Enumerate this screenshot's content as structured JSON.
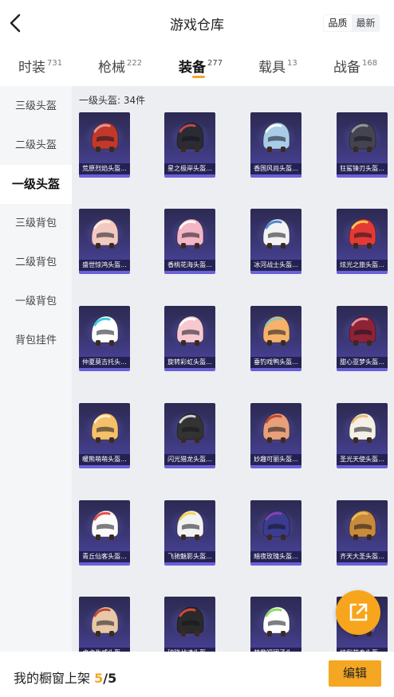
{
  "header": {
    "title": "游戏仓库",
    "sort": [
      "品质",
      "最新"
    ],
    "back_icon": "back-arrow-icon"
  },
  "tabs": [
    {
      "label": "时装",
      "count": "731",
      "active": false
    },
    {
      "label": "枪械",
      "count": "222",
      "active": false
    },
    {
      "label": "装备",
      "count": "277",
      "active": true
    },
    {
      "label": "载具",
      "count": "13",
      "active": false
    },
    {
      "label": "战备",
      "count": "168",
      "active": false
    }
  ],
  "sidebar": {
    "items": [
      {
        "label": "三级头盔",
        "active": false
      },
      {
        "label": "二级头盔",
        "active": false
      },
      {
        "label": "一级头盔",
        "active": true
      },
      {
        "label": "三级背包",
        "active": false
      },
      {
        "label": "二级背包",
        "active": false
      },
      {
        "label": "一级背包",
        "active": false
      },
      {
        "label": "背包挂件",
        "active": false
      }
    ]
  },
  "content": {
    "heading_prefix": "一级头盔:",
    "heading_count": "34件",
    "items": [
      {
        "name": "荒原烈焰头盔...",
        "color": "#c0392b",
        "accent": "#e8a0a0"
      },
      {
        "name": "星之极岸头盔...",
        "color": "#2b2b35",
        "accent": "#d24a4a"
      },
      {
        "name": "香国风尚头盔...",
        "color": "#a9cde8",
        "accent": "#ffffff"
      },
      {
        "name": "狂鲨锋刃头盔...",
        "color": "#444450",
        "accent": "#9aa0aa"
      },
      {
        "name": "盛世惊鸿头盔...",
        "color": "#f2c9c0",
        "accent": "#fff0e8"
      },
      {
        "name": "香桃花海头盔...",
        "color": "#f4b6c4",
        "accent": "#ffffff"
      },
      {
        "name": "冰河战士头盔...",
        "color": "#f2f2f2",
        "accent": "#3a7bd5"
      },
      {
        "name": "炫光之旅头盔...",
        "color": "#e53935",
        "accent": "#ffd54f"
      },
      {
        "name": "仲夏莫吉托头...",
        "color": "#ffffff",
        "accent": "#26c6da"
      },
      {
        "name": "旋转彩虹头盔...",
        "color": "#f8c8d0",
        "accent": "#ffffff"
      },
      {
        "name": "垂钓戏鸭头盔...",
        "color": "#f6b26b",
        "accent": "#7fc8c8"
      },
      {
        "name": "甜心亚梦头盔...",
        "color": "#8e2236",
        "accent": "#e89aa8"
      },
      {
        "name": "暖熊萌萌头盔...",
        "color": "#f4c06a",
        "accent": "#fff3d0"
      },
      {
        "name": "闪光猎龙头盔...",
        "color": "#333333",
        "accent": "#e0e0e0"
      },
      {
        "name": "妙趣可丽头盔...",
        "color": "#e8a07a",
        "accent": "#c0392b"
      },
      {
        "name": "圣光天使头盔...",
        "color": "#f5f0e6",
        "accent": "#e6b86a"
      },
      {
        "name": "青丘仙客头盔...",
        "color": "#fafafa",
        "accent": "#e53935"
      },
      {
        "name": "飞驰魅影头盔...",
        "color": "#f2f2f2",
        "accent": "#f4d03f"
      },
      {
        "name": "暗夜玫瑰头盔...",
        "color": "#3b3b8f",
        "accent": "#8e44ad"
      },
      {
        "name": "齐天大圣头盔...",
        "color": "#c98a3a",
        "accent": "#f0c060"
      },
      {
        "name": "虎虎生威头盔...",
        "color": "#e8c8a8",
        "accent": "#c0392b"
      },
      {
        "name": "破晓战魂头盔...",
        "color": "#2a2a2a",
        "accent": "#e74c3c"
      },
      {
        "name": "萌趣福团子头...",
        "color": "#ffffff",
        "accent": "#7ed957"
      },
      {
        "name": "炫彩节奏头盔...",
        "color": "#6a4fcf",
        "accent": "#f39c12"
      }
    ]
  },
  "fab": {
    "icon": "share-external-icon"
  },
  "bottom": {
    "label": "我的橱窗上架",
    "current": "5",
    "separator": "/",
    "max": "5",
    "edit_label": "编辑"
  }
}
